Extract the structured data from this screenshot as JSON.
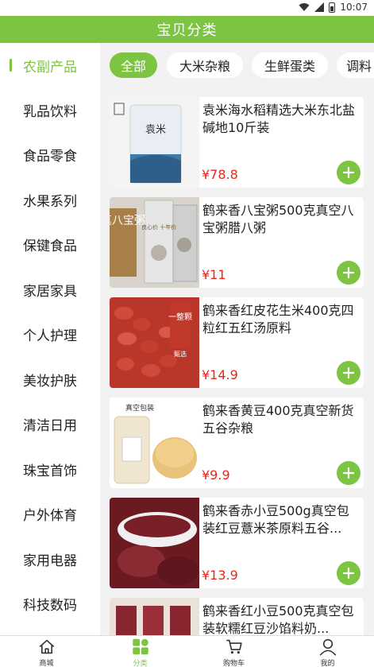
{
  "status_bar": {
    "time": "10:07"
  },
  "header": {
    "title": "宝贝分类"
  },
  "sidebar": {
    "items": [
      {
        "label": "农副产品",
        "active": true
      },
      {
        "label": "乳品饮料"
      },
      {
        "label": "食品零食"
      },
      {
        "label": "水果系列"
      },
      {
        "label": "保键食品"
      },
      {
        "label": "家居家具"
      },
      {
        "label": "个人护理"
      },
      {
        "label": "美妆护肤"
      },
      {
        "label": "清洁日用"
      },
      {
        "label": "珠宝首饰"
      },
      {
        "label": "户外体育"
      },
      {
        "label": "家用电器"
      },
      {
        "label": "科技数码"
      }
    ]
  },
  "tabs": [
    {
      "label": "全部",
      "active": true
    },
    {
      "label": "大米杂粮"
    },
    {
      "label": "生鲜蛋类"
    },
    {
      "label": "调料"
    }
  ],
  "products": [
    {
      "name": "袁米海水稻精选大米东北盐碱地10斤装",
      "price": "¥78.8",
      "image_text": [
        "袁米"
      ]
    },
    {
      "name": "鹤来香八宝粥500克真空八宝粥腊八粥",
      "price": "¥11",
      "image_text": [
        "真八宝粥",
        "良心价 十年价"
      ]
    },
    {
      "name": "鹤来香红皮花生米400克四粒红五红汤原料",
      "price": "¥14.9",
      "image_text": [
        "一整颗",
        "甄选"
      ]
    },
    {
      "name": "鹤来香黄豆400克真空新货五谷杂粮",
      "price": "¥9.9",
      "image_text": [
        "真空包装"
      ]
    },
    {
      "name": "鹤来香赤小豆500g真空包装红豆薏米茶原料五谷...",
      "price": "¥13.9",
      "image_text": []
    },
    {
      "name": "鹤来香红小豆500克真空包装软糯红豆沙馅料奶...",
      "price": "",
      "image_text": []
    }
  ],
  "tabbar": {
    "items": [
      {
        "label": "商城",
        "icon": "home-icon"
      },
      {
        "label": "分类",
        "icon": "category-icon",
        "active": true
      },
      {
        "label": "购物车",
        "icon": "cart-icon"
      },
      {
        "label": "我的",
        "icon": "user-icon"
      }
    ]
  },
  "colors": {
    "accent": "#7dc443",
    "price": "#e8271c",
    "background": "#f2f2f2"
  }
}
